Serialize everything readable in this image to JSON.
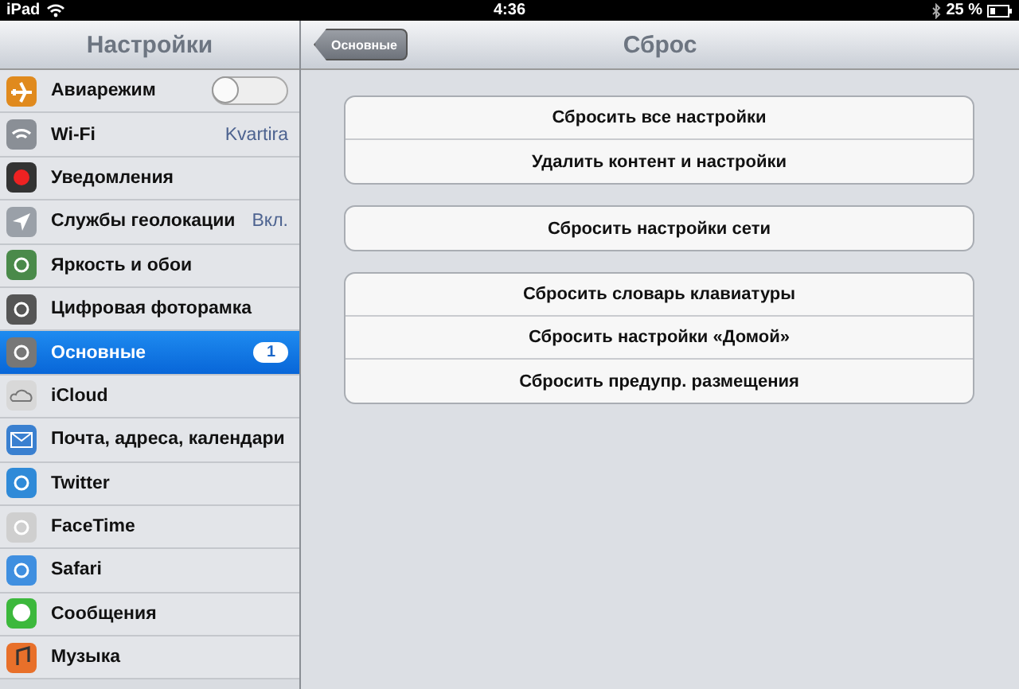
{
  "status_bar": {
    "device": "iPad",
    "time": "4:36",
    "battery": "25 %"
  },
  "sidebar": {
    "title": "Настройки",
    "items": [
      {
        "label": "Авиарежим",
        "kind": "toggle",
        "on": false,
        "selected": false
      },
      {
        "label": "Wi-Fi",
        "kind": "value",
        "value": "Kvartira",
        "selected": false
      },
      {
        "label": "Уведомления",
        "kind": "plain",
        "selected": false
      },
      {
        "label": "Службы геолокации",
        "kind": "value",
        "value": "Вкл.",
        "selected": false
      },
      {
        "label": "Яркость и обои",
        "kind": "plain",
        "selected": false
      },
      {
        "label": "Цифровая фоторамка",
        "kind": "plain",
        "selected": false
      },
      {
        "label": "Основные",
        "kind": "badge",
        "badge": "1",
        "selected": true
      },
      {
        "label": "iCloud",
        "kind": "plain",
        "selected": false
      },
      {
        "label": "Почта, адреса, календари",
        "kind": "plain",
        "selected": false
      },
      {
        "label": "Twitter",
        "kind": "plain",
        "selected": false
      },
      {
        "label": "FaceTime",
        "kind": "plain",
        "selected": false
      },
      {
        "label": "Safari",
        "kind": "plain",
        "selected": false
      },
      {
        "label": "Сообщения",
        "kind": "plain",
        "selected": false
      },
      {
        "label": "Музыка",
        "kind": "plain",
        "selected": false
      }
    ]
  },
  "detail": {
    "back_button": "Основные",
    "title": "Сброс",
    "groups": [
      [
        "Сбросить все настройки",
        "Удалить контент и настройки"
      ],
      [
        "Сбросить настройки сети"
      ],
      [
        "Сбросить словарь клавиатуры",
        "Сбросить настройки «Домой»",
        "Сбросить предупр. размещения"
      ]
    ]
  }
}
